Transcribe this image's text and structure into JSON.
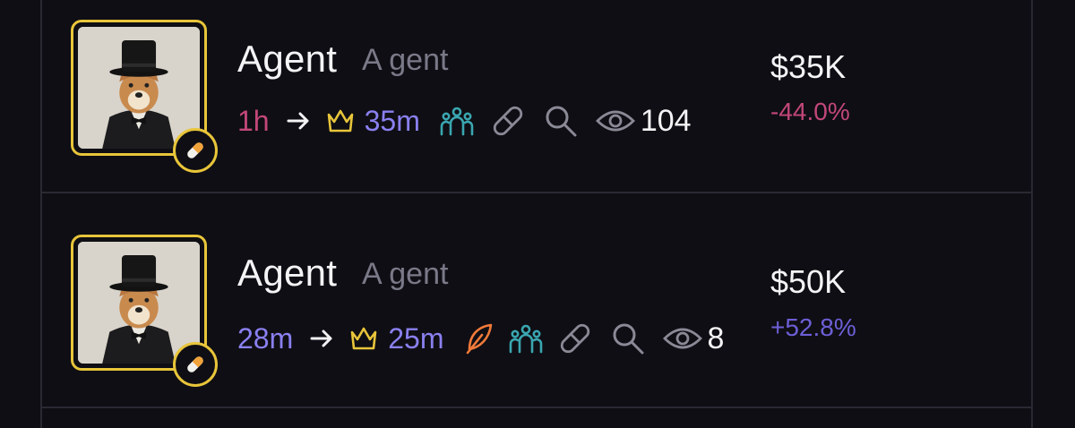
{
  "rows": [
    {
      "name": "Agent",
      "ticker": "A gent",
      "age": "1h",
      "crown_time": "35m",
      "views": "104",
      "market_cap": "$35K",
      "change": "-44.0%"
    },
    {
      "name": "Agent",
      "ticker": "A gent",
      "age": "28m",
      "crown_time": "25m",
      "views": "8",
      "market_cap": "$50K",
      "change": "+52.8%"
    }
  ],
  "colors": {
    "background": "#0f0e14",
    "border": "#2a2933",
    "avatar_ring": "#e8c53a",
    "negative": "#c2477a",
    "positive": "#6c5fd6",
    "time_purple": "#8a80f0",
    "crown": "#e8c53a",
    "community": "#3aa6b0",
    "feather": "#f07a3a",
    "muted_icon": "#8a8996"
  },
  "icons": [
    "pill-icon",
    "arrow-right-icon",
    "crown-icon",
    "community-icon",
    "link-icon",
    "search-icon",
    "eye-icon",
    "feather-icon"
  ]
}
